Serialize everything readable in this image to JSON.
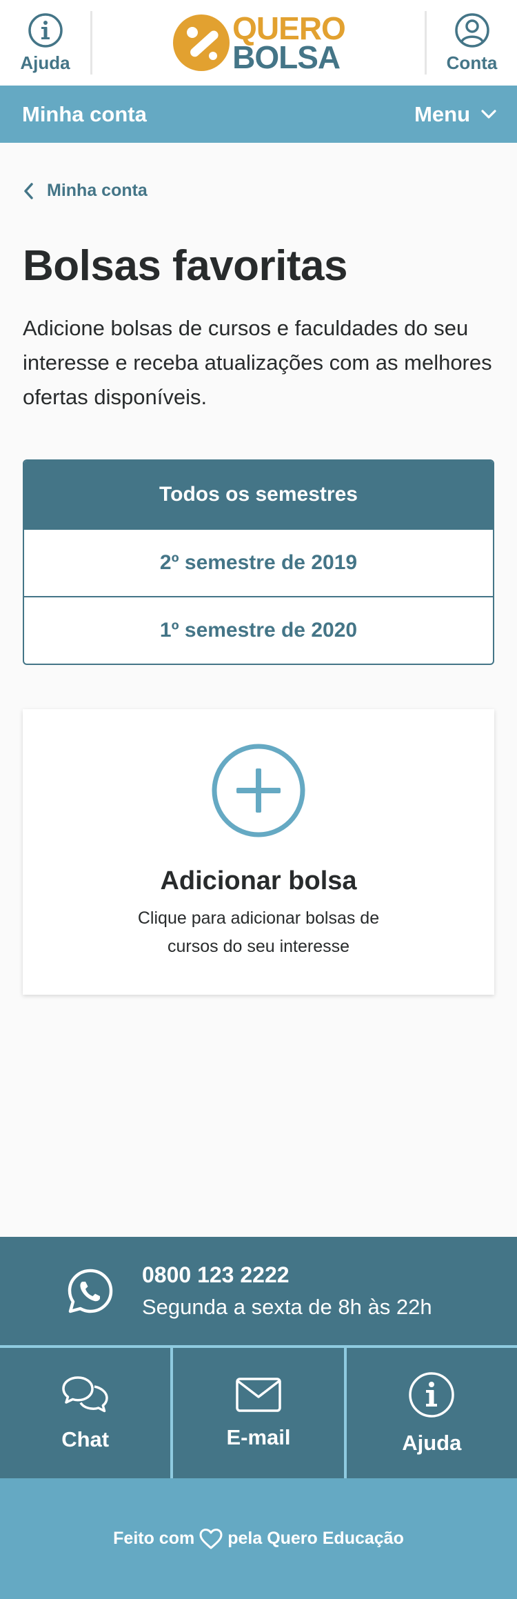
{
  "header": {
    "help_label": "Ajuda",
    "account_label": "Conta",
    "logo": {
      "line1": "QUERO",
      "line2": "BOLSA",
      "color_primary": "#e2a130",
      "color_secondary": "#447587"
    }
  },
  "subnav": {
    "title": "Minha conta",
    "menu_label": "Menu"
  },
  "breadcrumb": {
    "back_label": "Minha conta"
  },
  "page": {
    "title": "Bolsas favoritas",
    "intro": "Adicione bolsas de cursos e faculdades do seu interesse e receba atualizações com as melhores ofertas disponíveis."
  },
  "semesters": {
    "items": [
      {
        "label": "Todos os semestres",
        "active": true
      },
      {
        "label": "2º semestre de 2019",
        "active": false
      },
      {
        "label": "1º semestre de 2020",
        "active": false
      }
    ]
  },
  "add_card": {
    "title": "Adicionar bolsa",
    "description": "Clique para adicionar bolsas de cursos do seu interesse"
  },
  "footer": {
    "phone": "0800 123 2222",
    "hours": "Segunda a sexta de 8h às 22h",
    "actions": [
      {
        "label": "Chat",
        "icon": "chat-icon"
      },
      {
        "label": "E-mail",
        "icon": "email-icon"
      },
      {
        "label": "Ajuda",
        "icon": "info-icon"
      }
    ],
    "made_prefix": "Feito com",
    "made_suffix": "pela Quero Educação"
  },
  "colors": {
    "primary_dark": "#447587",
    "primary_light": "#65a9c3",
    "accent": "#e2a130",
    "divider": "#8fcbe0"
  }
}
